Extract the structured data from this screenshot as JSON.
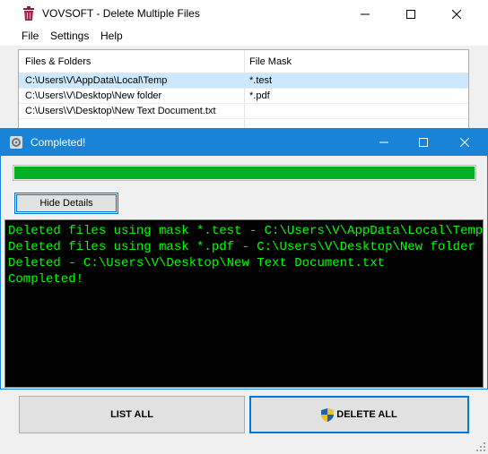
{
  "main_window": {
    "title": "VOVSOFT - Delete Multiple Files",
    "menu": [
      "File",
      "Settings",
      "Help"
    ],
    "columns": [
      "Files & Folders",
      "File Mask"
    ],
    "rows": [
      {
        "path": "C:\\Users\\V\\AppData\\Local\\Temp",
        "mask": "*.test",
        "selected": true
      },
      {
        "path": "C:\\Users\\V\\Desktop\\New folder",
        "mask": "*.pdf",
        "selected": false
      },
      {
        "path": "C:\\Users\\V\\Desktop\\New Text Document.txt",
        "mask": "",
        "selected": false
      }
    ],
    "buttons": {
      "list_all": "LIST ALL",
      "delete_all": "DELETE ALL"
    }
  },
  "dialog": {
    "title": "Completed!",
    "progress": 1.0,
    "hide_details_label": "Hide Details",
    "log": [
      "Deleted files using mask *.test - C:\\Users\\V\\AppData\\Local\\Temp",
      "Deleted files using mask *.pdf - C:\\Users\\V\\Desktop\\New folder",
      "Deleted - C:\\Users\\V\\Desktop\\New Text Document.txt",
      "Completed!"
    ]
  },
  "colors": {
    "dialog_titlebar": "#1883d7",
    "progress_fill": "#06b025",
    "console_text": "#00ff00",
    "selection": "#cce8ff"
  },
  "icons": [
    "trash-icon",
    "minimize-icon",
    "maximize-icon",
    "close-icon",
    "app-gear-icon",
    "uac-shield-icon",
    "resize-grip-icon"
  ]
}
